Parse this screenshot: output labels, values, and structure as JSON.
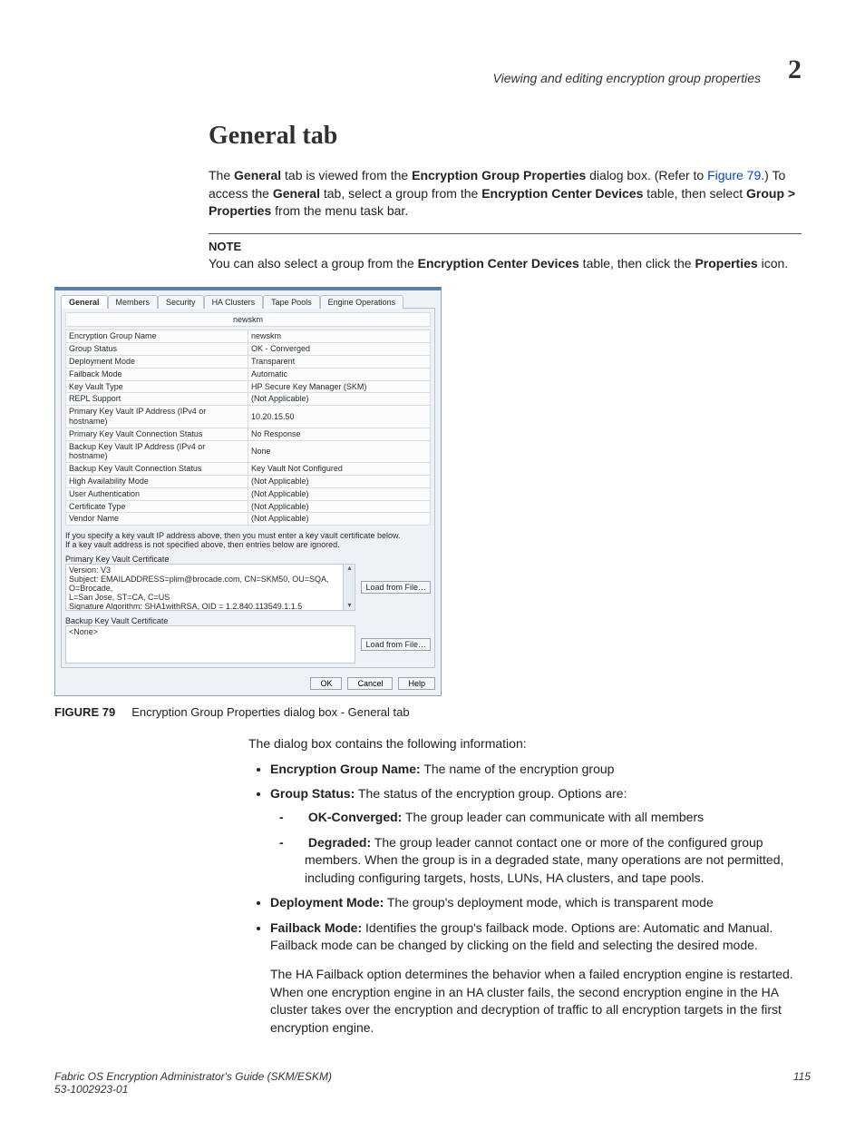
{
  "header": {
    "running_head": "Viewing and editing encryption group properties",
    "chapter_number": "2"
  },
  "section_title": "General tab",
  "intro": {
    "t1": "The ",
    "b1": "General",
    "t2": " tab is viewed from the ",
    "b2": "Encryption Group Properties",
    "t3": " dialog box. (Refer to ",
    "link1": "Figure 79",
    "t4": ".) To access the ",
    "b3": "General",
    "t5": " tab, select a group from the ",
    "b4": "Encryption Center Devices",
    "t6": " table, then select ",
    "b5": "Group > Properties",
    "t7": " from the menu task bar."
  },
  "note": {
    "head": "NOTE",
    "t1": "You can also select a group from the ",
    "b1": "Encryption Center Devices",
    "t2": " table, then click the ",
    "b2": "Properties",
    "t3": " icon."
  },
  "dialog": {
    "tabs": [
      "General",
      "Members",
      "Security",
      "HA Clusters",
      "Tape Pools",
      "Engine Operations"
    ],
    "title": "newskm",
    "rows": [
      {
        "k": "Encryption Group Name",
        "v": "newskm"
      },
      {
        "k": "Group Status",
        "v": "OK - Converged"
      },
      {
        "k": "Deployment Mode",
        "v": "Transparent"
      },
      {
        "k": "Failback Mode",
        "v": "Automatic"
      },
      {
        "k": "Key Vault Type",
        "v": "HP Secure Key Manager (SKM)"
      },
      {
        "k": "REPL Support",
        "v": "(Not Applicable)"
      },
      {
        "k": "Primary Key Vault IP Address (IPv4 or hostname)",
        "v": "10.20.15.50"
      },
      {
        "k": "Primary Key Vault Connection Status",
        "v": "No Response"
      },
      {
        "k": "Backup Key Vault IP Address (IPv4 or hostname)",
        "v": "None"
      },
      {
        "k": "Backup Key Vault Connection Status",
        "v": "Key Vault Not Configured"
      },
      {
        "k": "High Availability Mode",
        "v": "(Not Applicable)"
      },
      {
        "k": "User Authentication",
        "v": "(Not Applicable)"
      },
      {
        "k": "Certificate Type",
        "v": "(Not Applicable)"
      },
      {
        "k": "Vendor Name",
        "v": "(Not Applicable)"
      }
    ],
    "cert_instr1": "If you specify a key vault IP address above, then you must enter a key vault certificate below.",
    "cert_instr2": "If a key vault address is not specified above, then entries below are ignored.",
    "primary_label": "Primary Key Vault Certificate",
    "primary_lines": [
      "Version: V3",
      "Subject: EMAILADDRESS=plim@brocade.com, CN=SKM50, OU=SQA, O=Brocade,",
      "L=San Jose, ST=CA, C=US",
      "Signature Algorithm: SHA1withRSA, OID = 1.2.840.113549.1.1.5"
    ],
    "backup_label": "Backup Key Vault Certificate",
    "backup_value": "<None>",
    "load_btn": "Load from File…",
    "ok": "OK",
    "cancel": "Cancel",
    "help": "Help"
  },
  "caption": {
    "fignum": "FIGURE 79",
    "text": "Encryption Group Properties dialog box - General tab"
  },
  "after": {
    "lead": "The dialog box contains the following information:",
    "b1_lead": "Encryption Group Name:",
    "b1_txt": " The name of the encryption group",
    "b2_lead": "Group Status:",
    "b2_txt": " The status of the encryption group. Options are:",
    "b2a_lead": "OK-Converged:",
    "b2a_txt": " The group leader can communicate with all members",
    "b2b_lead": "Degraded:",
    "b2b_txt": " The group leader cannot contact one or more of the configured group members. When the group is in a degraded state, many operations are not permitted, including configuring targets, hosts, LUNs, HA clusters, and tape pools.",
    "b3_lead": "Deployment Mode:",
    "b3_txt": " The group's deployment mode, which is transparent mode",
    "b4_lead": "Failback Mode:",
    "b4_txt": " Identifies the group's failback mode. Options are: Automatic and Manual. Failback mode can be changed by clicking on the field and selecting the desired mode.",
    "b4_p2": "The HA Failback option determines the behavior when a failed encryption engine is restarted. When one encryption engine in an HA cluster fails, the second encryption engine in the HA cluster takes over the encryption and decryption of traffic to all encryption targets in the first encryption engine."
  },
  "footer": {
    "left1": "Fabric OS Encryption Administrator's Guide (SKM/ESKM)",
    "left2": "53-1002923-01",
    "right": "115"
  }
}
